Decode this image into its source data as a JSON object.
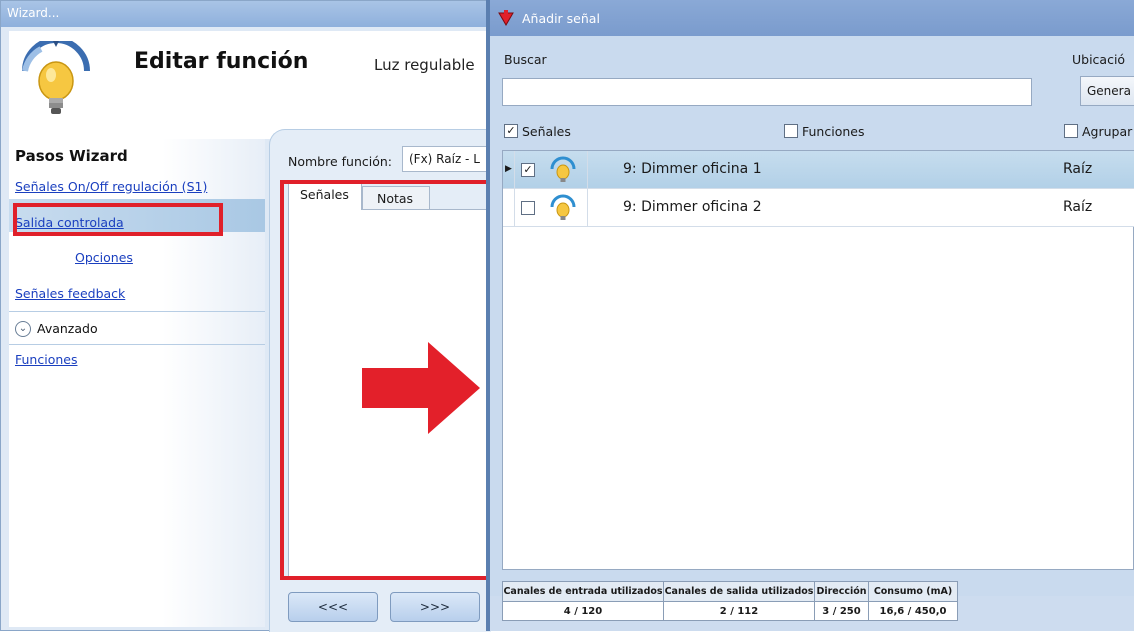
{
  "wizard": {
    "window_title": "Wizard...",
    "title": "Editar función",
    "subtitle": "Luz regulable",
    "steps_header": "Pasos Wizard",
    "steps": [
      "Señales On/Off regulación (S1)",
      "Salida controlada",
      "Opciones",
      "Señales feedback"
    ],
    "advanced_label": "Avanzado",
    "advanced_steps": [
      "Funciones"
    ],
    "function_name_label": "Nombre función:",
    "function_name_value": "(Fx) Raíz - L",
    "tabs": [
      "Señales",
      "Notas"
    ],
    "prev_button": "<<<",
    "next_button": ">>>",
    "highlight_color": "#e0202a"
  },
  "dialog": {
    "title": "Añadir señal",
    "search_label": "Buscar",
    "search_value": "",
    "location_label": "Ubicació",
    "location_value": "Genera",
    "filters": [
      {
        "label": "Señales",
        "checked": true
      },
      {
        "label": "Funciones",
        "checked": false
      },
      {
        "label": "Agrupar",
        "checked": false
      }
    ],
    "rows": [
      {
        "selected": true,
        "checked": true,
        "icon": "dimmer-light-icon",
        "name": "9: Dimmer oficina 1",
        "location": "Raíz"
      },
      {
        "selected": false,
        "checked": false,
        "icon": "dimmer-light-icon",
        "name": "9: Dimmer oficina 2",
        "location": "Raíz"
      }
    ],
    "stats": {
      "input_channels_label": "Canales de entrada utilizados",
      "input_channels_value": "4 / 120",
      "output_channels_label": "Canales de salida utilizados",
      "output_channels_value": "2 / 112",
      "address_label": "Dirección",
      "address_value": "3 / 250",
      "consumption_label": "Consumo (mA)",
      "consumption_value": "16,6 / 450,0"
    }
  }
}
